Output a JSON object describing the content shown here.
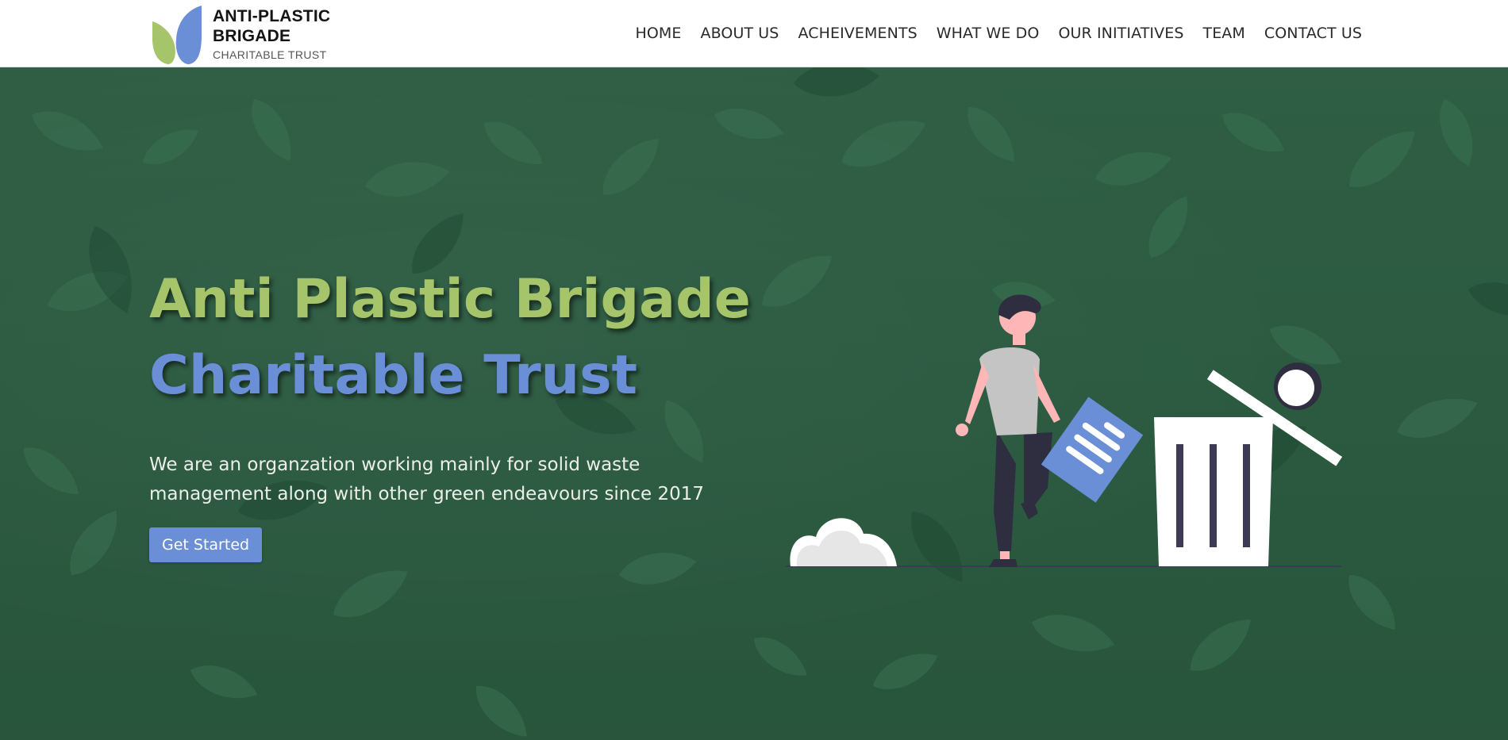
{
  "brand": {
    "line1": "ANTI-PLASTIC",
    "line2": "BRIGADE",
    "line3": "CHARITABLE TRUST",
    "colors": {
      "leaf_green": "#a6c46a",
      "leaf_blue": "#6b8fd6"
    }
  },
  "nav": {
    "items": [
      {
        "label": "HOME"
      },
      {
        "label": "ABOUT US"
      },
      {
        "label": "ACHEIVEMENTS"
      },
      {
        "label": "WHAT WE DO"
      },
      {
        "label": "OUR INITIATIVES"
      },
      {
        "label": "TEAM"
      },
      {
        "label": "CONTACT US"
      }
    ]
  },
  "hero": {
    "title_line1": "Anti Plastic Brigade",
    "title_line2": "Charitable Trust",
    "description": "We are an organzation working mainly for solid waste management along with other green endeavours since 2017",
    "cta_label": "Get Started",
    "background": "green leaves photo",
    "colors": {
      "title_green": "#a6c46a",
      "title_blue": "#6b8fd6",
      "button": "#6b8fd6"
    }
  },
  "illustration": {
    "subject": "person throwing paper into trash bin",
    "icons": [
      "person-figure",
      "paper-document-icon",
      "trash-bin-icon",
      "bush-icon"
    ]
  }
}
